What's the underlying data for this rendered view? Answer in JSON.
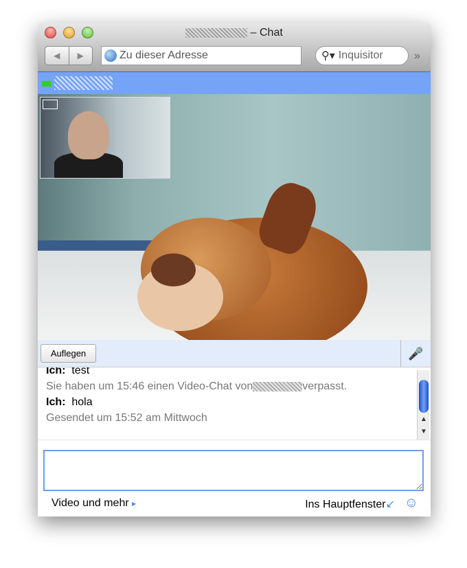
{
  "window": {
    "title_suffix": "– Chat",
    "traffic_lights": {
      "close": "#e0443e",
      "minimize": "#dea123",
      "zoom": "#5fbf3f"
    }
  },
  "toolbar": {
    "back_icon": "◀",
    "forward_icon": "▶",
    "address_placeholder": "Zu dieser Adresse",
    "search_placeholder": "Inquisitor",
    "overflow_icon": "»"
  },
  "controls": {
    "hangup_label": "Auflegen",
    "mic_icon": "🎤"
  },
  "chat": {
    "messages": [
      {
        "sender": "Ich:",
        "text": "test"
      },
      {
        "system_prefix": "Sie haben um 15:46 einen Video-Chat von",
        "system_suffix": "verpasst."
      },
      {
        "sender": "Ich:",
        "text": "hola"
      },
      {
        "status": "Gesendet um 15:52 am Mittwoch"
      }
    ]
  },
  "footer": {
    "video_more": "Video und mehr",
    "video_more_icon": "▸",
    "main_window": "Ins Hauptfenster",
    "main_window_icon": "↙",
    "emoji_icon": "☺"
  },
  "colors": {
    "accent": "#75a3f5",
    "input_border": "#6d9cf2"
  }
}
